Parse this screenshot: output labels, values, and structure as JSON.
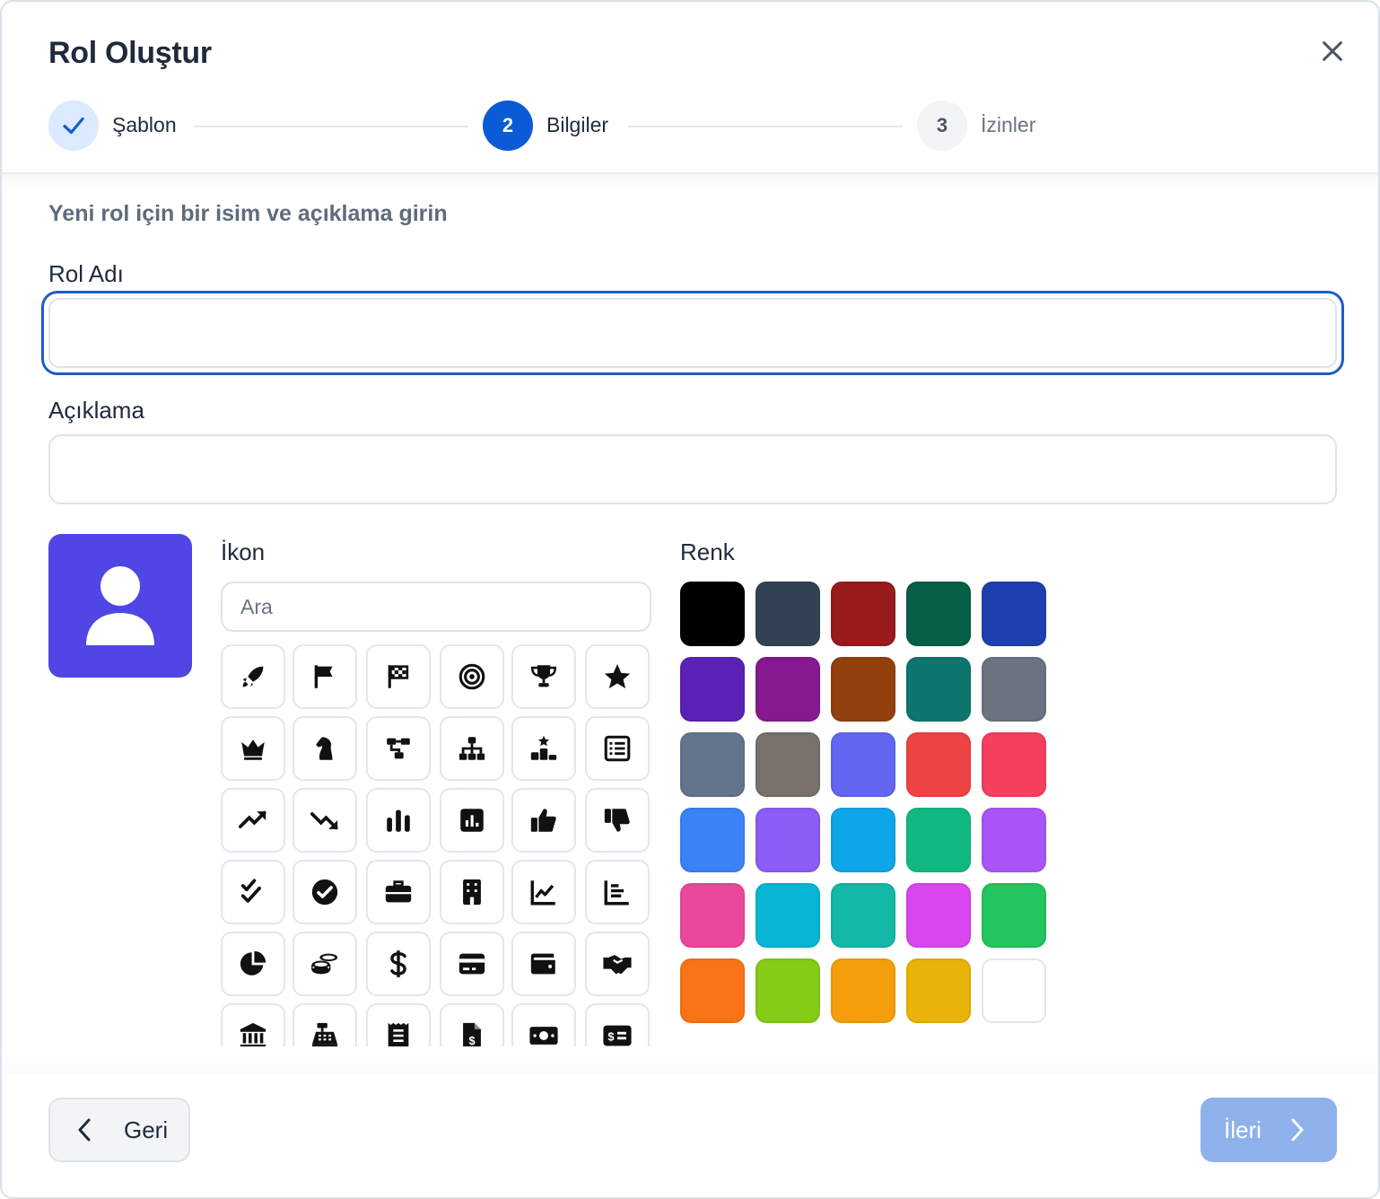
{
  "dialog": {
    "title": "Rol Oluştur",
    "close_icon": "close-icon"
  },
  "stepper": {
    "steps": [
      {
        "number": "",
        "label": "Şablon",
        "state": "completed",
        "icon": "check-icon"
      },
      {
        "number": "2",
        "label": "Bilgiler",
        "state": "active"
      },
      {
        "number": "3",
        "label": "İzinler",
        "state": "pending"
      }
    ]
  },
  "form": {
    "subtitle": "Yeni rol için bir isim ve açıklama girin",
    "name_label": "Rol Adı",
    "name_value": "",
    "description_label": "Açıklama",
    "description_value": ""
  },
  "preview": {
    "icon": "user-icon",
    "color": "#4f46e5"
  },
  "icon_picker": {
    "label": "İkon",
    "search_placeholder": "Ara",
    "icons": [
      "rocket-icon",
      "flag-icon",
      "flag-checkered-icon",
      "bullseye-icon",
      "trophy-icon",
      "star-icon",
      "crown-icon",
      "chess-knight-icon",
      "diagram-project-icon",
      "sitemap-icon",
      "ranking-star-icon",
      "table-list-icon",
      "arrow-trend-up-icon",
      "arrow-trend-down-icon",
      "chart-simple-icon",
      "square-poll-vertical-icon",
      "thumbs-up-icon",
      "thumbs-down-icon",
      "check-double-icon",
      "circle-check-icon",
      "briefcase-icon",
      "building-icon",
      "chart-line-icon",
      "chart-bar-icon",
      "chart-pie-icon",
      "coins-icon",
      "dollar-sign-icon",
      "credit-card-icon",
      "wallet-icon",
      "handshake-icon",
      "building-columns-icon",
      "cash-register-icon",
      "receipt-icon",
      "file-invoice-dollar-icon",
      "money-bill-icon",
      "money-check-dollar-icon"
    ]
  },
  "color_picker": {
    "label": "Renk",
    "colors": [
      "#000000",
      "#334155",
      "#991b1b",
      "#065f46",
      "#1e40af",
      "#5b21b6",
      "#86198f",
      "#92400e",
      "#0f766e",
      "#6b7280",
      "#64748b",
      "#78716c",
      "#6366f1",
      "#ef4444",
      "#f43f5e",
      "#3b82f6",
      "#8b5cf6",
      "#0ea5e9",
      "#10b981",
      "#a855f7",
      "#ec4899",
      "#06b6d4",
      "#14b8a6",
      "#d946ef",
      "#22c55e",
      "#f97316",
      "#84cc16",
      "#f59e0b",
      "#eab308",
      "#ffffff"
    ]
  },
  "footer": {
    "back_label": "Geri",
    "next_label": "İleri"
  }
}
